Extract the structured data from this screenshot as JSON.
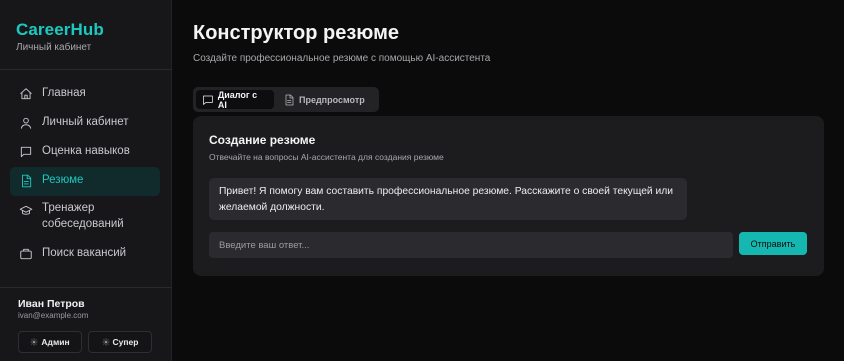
{
  "app": {
    "brand": "CareerHub",
    "brand_sub": "Личный кабинет",
    "accent": "#1cc9c0"
  },
  "sidebar": {
    "items": [
      {
        "label": "Главная",
        "icon": "home-icon"
      },
      {
        "label": "Личный кабинет",
        "icon": "user-icon"
      },
      {
        "label": "Оценка навыков",
        "icon": "message-square-icon"
      },
      {
        "label": "Резюме",
        "icon": "document-icon",
        "active": true
      },
      {
        "label": "Тренажер собеседований",
        "icon": "graduation-cap-icon"
      },
      {
        "label": "Поиск вакансий",
        "icon": "briefcase-icon"
      }
    ],
    "user": {
      "name": "Иван Петров",
      "email": "ivan@example.com"
    },
    "roles": [
      {
        "label": "Админ",
        "icon": "gear-icon"
      },
      {
        "label": "Супер",
        "icon": "gear-icon"
      }
    ]
  },
  "main": {
    "title": "Конструктор резюме",
    "subtitle": "Создайте профессиональное резюме с помощью AI-ассистента",
    "tabs": [
      {
        "label": "Диалог с AI",
        "icon": "chat-icon",
        "active": true
      },
      {
        "label": "Предпросмотр",
        "icon": "file-icon",
        "active": false
      }
    ],
    "card": {
      "title": "Создание резюме",
      "subtitle": "Отвечайте на вопросы AI-ассистента для создания резюме",
      "message": "Привет! Я помогу вам составить профессиональное резюме. Расскажите о своей текущей или желаемой должности.",
      "input_placeholder": "Введите ваш ответ...",
      "input_value": "",
      "send_label": "Отправить"
    }
  }
}
